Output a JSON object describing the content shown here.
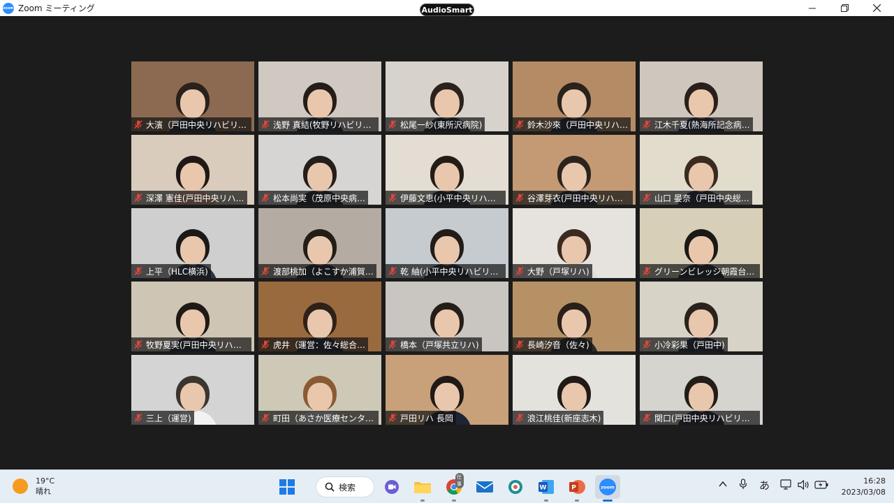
{
  "window": {
    "title": "Zoom ミーティング",
    "audio_badge": "AudioSmart",
    "logo_text": "zoom"
  },
  "participants": [
    {
      "name": "大濱（戸田中央リハビリテ…",
      "bg": "#8c6a52",
      "hair": "#2a211c",
      "shirt": "#1d2433"
    },
    {
      "name": "浅野 真結(牧野リハビリテ…",
      "bg": "#cfc9c2",
      "hair": "#241c18",
      "shirt": "#222a38"
    },
    {
      "name": "松尾一紗(東所沢病院)",
      "bg": "#d8d2cd",
      "hair": "#2b221d",
      "shirt": "#1e2434"
    },
    {
      "name": "鈴木沙來（戸田中央リハ…",
      "bg": "#b58b66",
      "hair": "#2a221c",
      "shirt": "#1e2536"
    },
    {
      "name": "江木千夏(熱海所記念病…",
      "bg": "#cfc7be",
      "hair": "#2a201b",
      "shirt": "#222c44"
    },
    {
      "name": "深澤 憲佳(戸田中央リハ…",
      "bg": "#d9ccbc",
      "hair": "#1f1915",
      "shirt": "#e5a58c"
    },
    {
      "name": "松本尚実（茂原中央病…",
      "bg": "#d7d5d3",
      "hair": "#251e1a",
      "shirt": "#1d2433"
    },
    {
      "name": "伊藤文恵(小平中央リハビ…",
      "bg": "#e3ddd4",
      "hair": "#241c17",
      "shirt": "#1d2433"
    },
    {
      "name": "谷澤芽衣(戸田中央リハビ…",
      "bg": "#c39a73",
      "hair": "#2b241e",
      "shirt": "#1e2434"
    },
    {
      "name": "山口 晏奈（戸田中央総…",
      "bg": "#e2dccd",
      "hair": "#3a2a1f",
      "shirt": "#222a3a"
    },
    {
      "name": "上平（HLC横浜)",
      "bg": "#cfcfcf",
      "hair": "#1c1a18",
      "shirt": "#2a3548"
    },
    {
      "name": "渡部桃加（よこすか浦賀…",
      "bg": "#b4aca3",
      "hair": "#231d18",
      "shirt": "#1c222e"
    },
    {
      "name": "乾 紬(小平中央リハビリテ…",
      "bg": "#c5cbcf",
      "hair": "#221c18",
      "shirt": "#1d2433"
    },
    {
      "name": "大野（戸塚リハ)",
      "bg": "#e6e2dd",
      "hair": "#3a2a20",
      "shirt": "#dcdcdc"
    },
    {
      "name": "グリーンビレッジ朝霞台いけや",
      "bg": "#d8cfb9",
      "hair": "#1b1816",
      "shirt": "#1b2030"
    },
    {
      "name": "牧野夏実(戸田中央リハビ…",
      "bg": "#cfc5b4",
      "hair": "#1f1a16",
      "shirt": "#1e2434"
    },
    {
      "name": "虎井（運営：佐々総合…",
      "bg": "#9a6a3f",
      "hair": "#2e2119",
      "shirt": "#1d2433"
    },
    {
      "name": "橋本（戸塚共立リハ)",
      "bg": "#c9c5c0",
      "hair": "#241d18",
      "shirt": "#f0f0f0"
    },
    {
      "name": "長崎汐音（佐々)",
      "bg": "#b79166",
      "hair": "#2a2019",
      "shirt": "#2a2a2a"
    },
    {
      "name": "小冷彩果（戸田中)",
      "bg": "#d7d3c6",
      "hair": "#2a221c",
      "shirt": "#222a3a"
    },
    {
      "name": "三上（運営)",
      "bg": "#d4d4d4",
      "hair": "#3b3530",
      "shirt": "#f2f2f2"
    },
    {
      "name": "町田（あさか医療センター)",
      "bg": "#cec9b6",
      "hair": "#8a5a34",
      "shirt": "#e9e9e9"
    },
    {
      "name": "戸田リハ 長岡",
      "bg": "#c8a07a",
      "hair": "#201a16",
      "shirt": "#1d2433"
    },
    {
      "name": "浪江桃佳(新座志木)",
      "bg": "#e4e2dd",
      "hair": "#211b17",
      "shirt": "#f2f2f2"
    },
    {
      "name": "関口(戸田中央リハビリテー…",
      "bg": "#d6d4cf",
      "hair": "#231d18",
      "shirt": "#1d2433"
    }
  ],
  "taskbar": {
    "weather": {
      "temp": "19°C",
      "condition": "晴れ"
    },
    "search_label": "検索",
    "chrome_badge": "仕事",
    "ime": "あ",
    "time": "16:28",
    "date": "2023/03/08"
  },
  "colors": {
    "muted_red": "#e0463c",
    "accent_blue": "#2d8cff"
  }
}
